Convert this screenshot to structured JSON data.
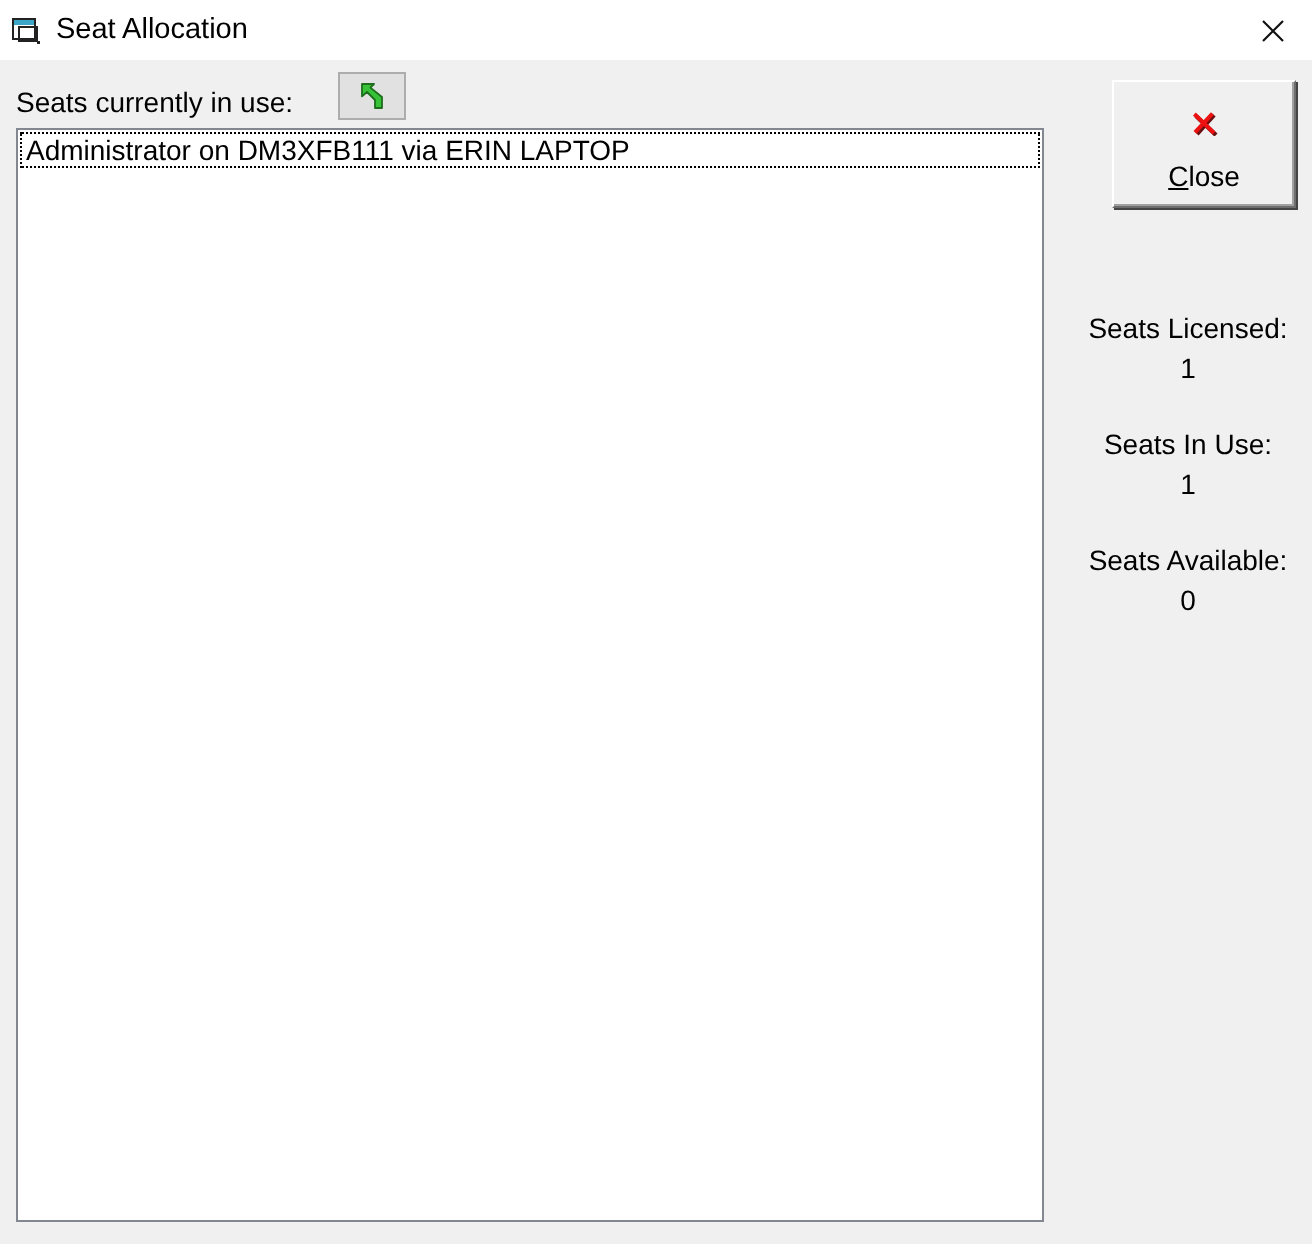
{
  "window": {
    "title": "Seat Allocation"
  },
  "seats_list": {
    "label": "Seats currently in use:",
    "items": [
      {
        "text": "Administrator on DM3XFB111 via ERIN LAPTOP",
        "selected": true
      }
    ]
  },
  "close_button": {
    "label": "Close"
  },
  "stats": [
    {
      "label": "Seats Licensed:",
      "value": "1"
    },
    {
      "label": "Seats In Use:",
      "value": "1"
    },
    {
      "label": "Seats Available:",
      "value": "0"
    }
  ]
}
